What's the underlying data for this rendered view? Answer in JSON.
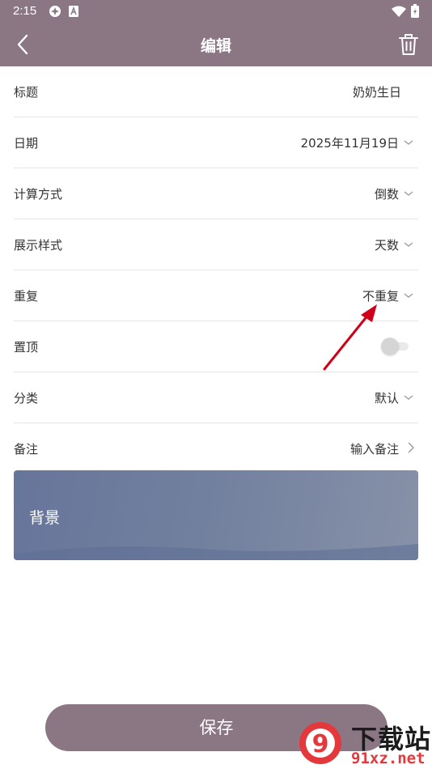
{
  "status_bar": {
    "time": "2:15"
  },
  "header": {
    "title": "编辑"
  },
  "rows": [
    {
      "label": "标题",
      "value": "奶奶生日"
    },
    {
      "label": "日期",
      "value": "2025年11月19日"
    },
    {
      "label": "计算方式",
      "value": "倒数"
    },
    {
      "label": "展示样式",
      "value": "天数"
    },
    {
      "label": "重复",
      "value": "不重复"
    },
    {
      "label": "置顶",
      "toggle_on": false
    },
    {
      "label": "分类",
      "value": "默认"
    },
    {
      "label": "备注",
      "value": "输入备注"
    }
  ],
  "background_card": {
    "label": "背景"
  },
  "save_button": {
    "label": "保存"
  },
  "watermark": {
    "title": "下载站",
    "url": "91xz.net",
    "logo_text": "9"
  },
  "colors": {
    "header": "#8b7684",
    "annotation_arrow": "#d0021b",
    "watermark_red": "#e4393c"
  }
}
